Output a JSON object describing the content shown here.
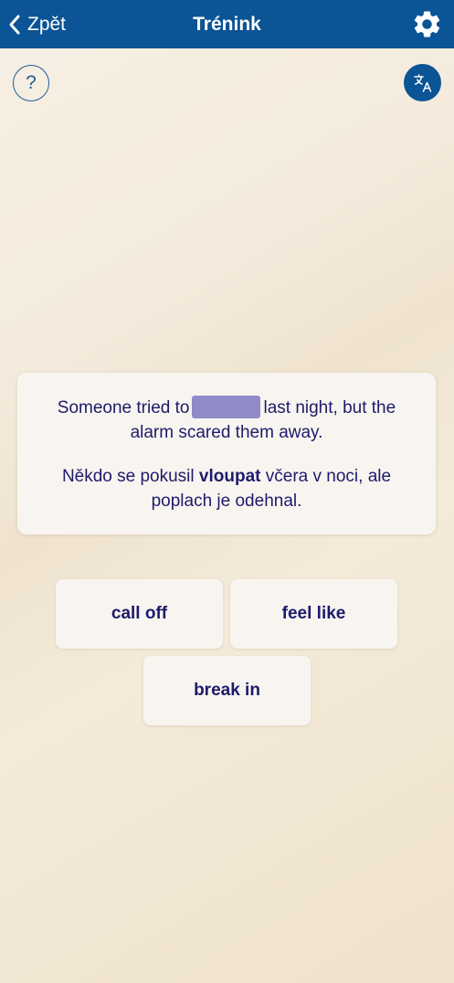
{
  "header": {
    "back_label": "Zpět",
    "title": "Trénink",
    "background": "#0b5495"
  },
  "icons": {
    "back": "chevron-left-icon",
    "settings": "gear-icon",
    "help": "question-mark-icon",
    "translate": "translate-icon"
  },
  "help": {
    "symbol": "?"
  },
  "sentence": {
    "en_before": "Someone tried to",
    "en_after": "last night, but the alarm scared them away.",
    "cz_before": "Někdo se pokusil",
    "cz_highlight": "vloupat",
    "cz_after": "včera v noci, ale poplach je odehnal."
  },
  "options": [
    {
      "label": "call off"
    },
    {
      "label": "feel like"
    },
    {
      "label": "break in"
    }
  ],
  "colors": {
    "text": "#1e1a6b",
    "blank": "#908bc8",
    "accent": "#0b5495"
  }
}
